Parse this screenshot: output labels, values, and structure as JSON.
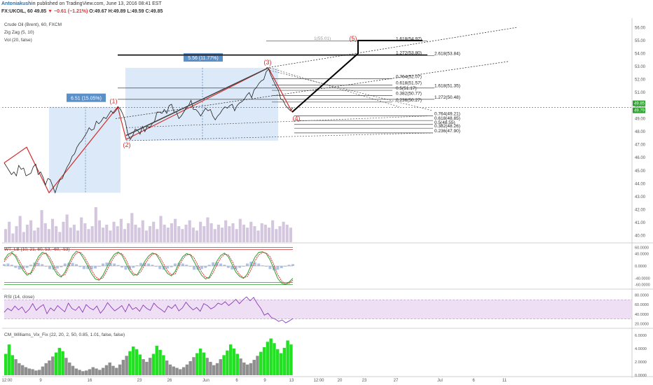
{
  "header": {
    "author": "Antoniakushin",
    "published": "published on TradingView.com, June 13, 2016 08:41 EST",
    "symbol": "FX:UKOIL, 60",
    "last": "49.85",
    "change": "▼ −0.61 (−1.21%)",
    "open": "O:49.67",
    "high": "H:49.89",
    "low": "L:49.59",
    "close": "C:49.85"
  },
  "legend": {
    "main": "Crude Oil (Brent), 60, FXCM",
    "zigzag": "Zig Zag (5, 10)",
    "vol": "Vol (20, false)",
    "wt": "WT_LB (10, 21, 60, 53, -60, -53)",
    "rsi": "RSI (14, close)",
    "vix": "CM_Williams_Vix_Fix (22, 20, 2, 50, 0.85, 1.01, false, false)"
  },
  "price_tags": {
    "last": "49.85",
    "close": "49.79"
  },
  "colors": {
    "price_line": "#1f1f1f",
    "zigzag": "#d32f2f",
    "projection": "#000000",
    "box_fill": "#cfe2f5",
    "volume": "#c9b8d6",
    "wt_upper": "#d32f2f",
    "wt_lower": "#2e9e2e",
    "rsi": "#8b3bb6",
    "rsi_band": "#ead7f2",
    "vix_green": "#22e022",
    "vix_gray": "#8f8f8f",
    "axis_tag": "#2e9e2e"
  },
  "chart_data": [
    {
      "type": "line",
      "title": "Crude Oil (Brent), 60, FXCM",
      "x_ticks": [
        "12:00",
        "9",
        "16",
        "23",
        "26",
        "Jun",
        "6",
        "9",
        "13",
        "12:00",
        "20",
        "23",
        "27",
        "Jul",
        "6",
        "11"
      ],
      "y_ticks": [
        40,
        41,
        42,
        43,
        44,
        45,
        46,
        47,
        48,
        49,
        50,
        51,
        52,
        53,
        54,
        55,
        56
      ],
      "ylim": [
        39.5,
        56.5
      ],
      "series": [
        {
          "values": [
            45.6,
            45.3,
            45.0,
            44.7,
            44.9,
            44.6,
            45.4,
            45.1,
            45.2,
            44.6,
            44.7,
            44.8,
            45.3,
            45.5,
            44.7,
            44.9,
            44.5,
            43.9,
            44.4,
            44.3,
            43.8,
            43.3,
            43.9,
            44.3,
            44.4,
            44.9,
            45.3,
            45.6,
            46.1,
            46.3,
            46.8,
            47.1,
            47.3,
            47.6,
            47.9,
            48.3,
            48.1,
            48.2,
            48.8,
            48.6,
            48.8,
            49.1,
            49.0,
            49.3,
            49.6,
            49.4,
            49.6,
            49.9,
            49.7,
            49.3,
            48.7,
            47.8,
            47.4,
            47.7,
            48.2,
            48.1,
            47.8,
            48.4,
            48.0,
            48.4,
            48.3,
            48.6,
            48.8,
            49.5,
            49.5,
            49.4,
            49.7,
            49.4,
            50.0,
            50.1,
            49.5,
            49.5,
            49.0,
            49.2,
            49.5,
            49.8,
            50.0,
            50.4,
            49.7,
            49.7,
            49.5,
            49.2,
            49.5,
            49.8,
            49.6,
            49.7,
            49.2,
            48.9,
            49.2,
            49.4,
            49.7,
            49.9,
            49.8,
            50.0,
            50.1,
            49.6,
            50.0,
            50.2,
            50.3,
            50.5,
            50.8,
            51.0,
            50.6,
            51.2,
            51.4,
            51.7,
            51.9,
            52.0,
            52.6,
            52.8,
            52.3,
            51.9,
            51.5,
            51.2,
            50.5,
            50.4,
            50.0,
            49.8,
            49.6,
            49.85
          ]
        }
      ],
      "waves": [
        {
          "label": "(1)",
          "value": 49.9
        },
        {
          "label": "(2)",
          "value": 47.4
        },
        {
          "label": "(3)",
          "value": 52.9
        },
        {
          "label": "(4)",
          "value": 49.5
        },
        {
          "label": "(5)",
          "value": 55.0
        }
      ],
      "measures": [
        {
          "label": "6.51 (15.05%)"
        },
        {
          "label": "5.56 (11.77%)"
        }
      ],
      "fib_labels": [
        "1.618(54.97)",
        "1.272(53.80)",
        "2.618(53.84)",
        "0.764(52.07)",
        "0.618(51.57)",
        "0.5(51.17)",
        "1.618(51.35)",
        "0.382(50.77)",
        "1.272(50.48)",
        "0.236(50.27)",
        "0.764(49.21)",
        "0.618(48.85)",
        "0.5(48.55)",
        "0.382(48.26)",
        "0.236(47.90)",
        "1(55.01)"
      ]
    },
    {
      "type": "line",
      "title": "WT_LB (10, 21, 60, 53, -60, -53)",
      "y_ticks": [
        "60.0000",
        "40.0000",
        "0.0000",
        "-40.0000",
        "-60.0000"
      ],
      "ylim": [
        -68,
        68
      ],
      "series": [
        {
          "name": "wt1",
          "values": [
            20,
            38,
            44,
            30,
            5,
            -15,
            -30,
            -22,
            5,
            30,
            44,
            40,
            18,
            -8,
            -28,
            -36,
            -20,
            8,
            34,
            48,
            42,
            22,
            0,
            -25,
            -42,
            -46,
            -30,
            -5,
            20,
            38,
            45,
            35,
            10,
            -15,
            -30,
            -28,
            -8,
            15,
            32,
            42,
            38,
            18,
            -6,
            -24,
            -32,
            -18,
            10,
            30,
            40,
            36,
            14,
            -10,
            -30,
            -42,
            -36,
            -10,
            16,
            34,
            42,
            30,
            5,
            -20,
            -34,
            -40,
            -26,
            2,
            28,
            44,
            46,
            40,
            20,
            -10,
            -40,
            -55,
            -60,
            -52,
            -40
          ]
        },
        {
          "name": "wt2",
          "values": [
            14,
            30,
            40,
            36,
            16,
            -6,
            -24,
            -26,
            -6,
            20,
            38,
            42,
            28,
            4,
            -20,
            -32,
            -28,
            -2,
            24,
            42,
            45,
            32,
            10,
            -14,
            -34,
            -44,
            -38,
            -16,
            10,
            30,
            42,
            40,
            22,
            -4,
            -24,
            -30,
            -18,
            5,
            24,
            38,
            40,
            28,
            6,
            -16,
            -28,
            -26,
            0,
            22,
            36,
            38,
            26,
            2,
            -20,
            -36,
            -40,
            -22,
            4,
            26,
            38,
            36,
            16,
            -10,
            -28,
            -38,
            -34,
            -12,
            16,
            36,
            44,
            42,
            30,
            4,
            -28,
            -48,
            -58,
            -56,
            -46
          ]
        },
        {
          "name": "diff",
          "values": [
            6,
            8,
            4,
            -6,
            -11,
            -9,
            -6,
            4,
            11,
            10,
            6,
            -2,
            -10,
            -12,
            -8,
            -4,
            8,
            10,
            10,
            6,
            -3,
            -10,
            -10,
            -11,
            -8,
            -2,
            8,
            11,
            10,
            8,
            3,
            -5,
            -12,
            -11,
            -6,
            2,
            10,
            10,
            8,
            4,
            -2,
            -10,
            -12,
            -8,
            -4,
            8,
            10,
            8,
            4,
            -2,
            -12,
            -12,
            -10,
            -6,
            4,
            12,
            12,
            8,
            4,
            -6,
            -11,
            -10,
            -6,
            -2,
            8,
            14,
            12,
            8,
            2,
            -2,
            -10,
            -14,
            -12,
            -7,
            -2,
            4,
            6
          ]
        }
      ]
    },
    {
      "type": "line",
      "title": "RSI (14, close)",
      "y_ticks": [
        "80.0000",
        "60.0000",
        "40.0000",
        "20.0000"
      ],
      "ylim": [
        15,
        85
      ],
      "series": [
        {
          "name": "RSI",
          "values": [
            44,
            52,
            47,
            57,
            49,
            55,
            43,
            50,
            62,
            48,
            55,
            60,
            41,
            53,
            47,
            58,
            51,
            45,
            63,
            52,
            48,
            56,
            44,
            60,
            53,
            49,
            57,
            42,
            51,
            64,
            55,
            47,
            52,
            58,
            45,
            61,
            50,
            54,
            46,
            59,
            52,
            48,
            63,
            55,
            50,
            44,
            57,
            52,
            60,
            47,
            53,
            65,
            56,
            49,
            54,
            46,
            62,
            58,
            51,
            55,
            63,
            60,
            66,
            58,
            64,
            71,
            62,
            70,
            76,
            68,
            75,
            62,
            52,
            38,
            42,
            33,
            30,
            25,
            28,
            22,
            26,
            31
          ]
        },
        {
          "name": "upper",
          "values": [
            70
          ]
        },
        {
          "name": "lower",
          "values": [
            30
          ]
        }
      ]
    },
    {
      "type": "bar",
      "title": "CM_Williams_Vix_Fix (22, 20, 2, 50, 0.85, 1.01, false, false)",
      "y_ticks": [
        "6.0000",
        "4.0000",
        "2.0000",
        "0.0000"
      ],
      "ylim": [
        0,
        6.5
      ],
      "highlight_threshold": 3.0,
      "values": [
        3.2,
        4.6,
        3.0,
        2.4,
        1.8,
        1.5,
        1.2,
        1.0,
        0.9,
        0.7,
        0.8,
        1.3,
        1.8,
        2.2,
        2.8,
        3.4,
        4.1,
        3.6,
        2.6,
        1.9,
        1.4,
        1.0,
        0.8,
        0.6,
        0.7,
        0.9,
        1.2,
        1.0,
        0.8,
        1.1,
        1.5,
        1.9,
        1.4,
        1.1,
        1.6,
        2.3,
        2.9,
        3.6,
        4.3,
        3.9,
        3.1,
        2.4,
        2.0,
        2.6,
        3.2,
        4.4,
        3.8,
        3.0,
        2.2,
        1.6,
        1.3,
        1.1,
        0.9,
        1.2,
        1.6,
        2.1,
        2.7,
        3.3,
        4.0,
        3.4,
        2.6,
        2.0,
        1.5,
        1.8,
        2.4,
        3.0,
        3.7,
        4.6,
        4.0,
        3.2,
        2.5,
        1.9,
        1.6,
        1.8,
        2.3,
        2.9,
        3.5,
        4.2,
        5.0,
        5.5,
        4.8,
        3.9,
        3.3,
        4.1,
        5.2,
        4.6
      ]
    },
    {
      "type": "bar",
      "title": "Vol (20, false)",
      "values": [
        9,
        14,
        6,
        11,
        18,
        7,
        12,
        15,
        8,
        10,
        22,
        13,
        9,
        16,
        11,
        7,
        14,
        19,
        10,
        12,
        8,
        17,
        13,
        9,
        11,
        24,
        15,
        10,
        12,
        8,
        14,
        11,
        16,
        9,
        13,
        20,
        12,
        10,
        15,
        8,
        11,
        14,
        9,
        18,
        12,
        10,
        13,
        16,
        11,
        9,
        12,
        15,
        10,
        8,
        14,
        11,
        17,
        13,
        9,
        12,
        10,
        15,
        11,
        13,
        9,
        16,
        12,
        10,
        14,
        11,
        8,
        13,
        12,
        10,
        15,
        9,
        11,
        14,
        12,
        10
      ]
    }
  ]
}
